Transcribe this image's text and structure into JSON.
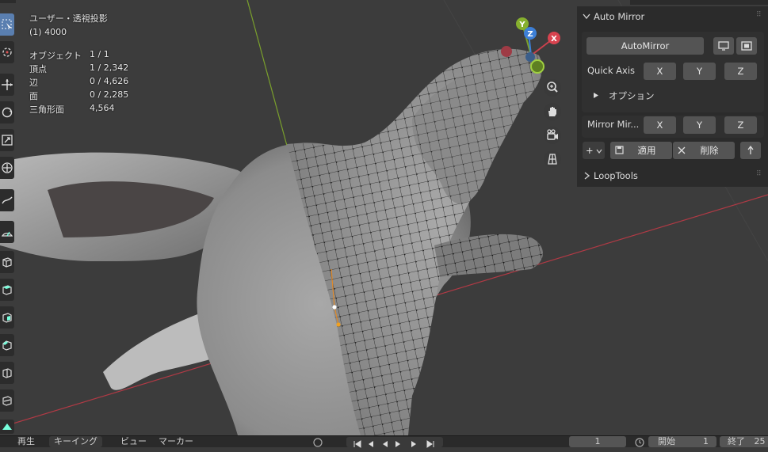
{
  "viewport": {
    "view_name": "ユーザー・透視投影",
    "object_name": "(1) 4000",
    "stats": [
      {
        "label": "オブジェクト",
        "value": "1 / 1"
      },
      {
        "label": "頂点",
        "value": "1 / 2,342"
      },
      {
        "label": "辺",
        "value": "0 / 4,626"
      },
      {
        "label": "面",
        "value": "0 / 2,285"
      },
      {
        "label": "三角形面",
        "value": "4,564"
      }
    ],
    "gizmo": {
      "x": "X",
      "y": "Y",
      "z": "Z"
    }
  },
  "toolbar": {
    "tools": [
      "select-box",
      "cursor",
      "move",
      "rotate",
      "scale",
      "transform",
      "annotate",
      "measure",
      "add-cube",
      "extrude",
      "inset",
      "bevel",
      "loop-cut",
      "knife",
      "poly-build"
    ]
  },
  "npanel": {
    "auto_mirror": {
      "title": "Auto Mirror",
      "automirror_button": "AutoMirror",
      "quick_axis_label": "Quick Axis",
      "axes": [
        "X",
        "Y",
        "Z"
      ],
      "options_label": "オプション",
      "mirror_label": "Mirror Mir...",
      "mirror_axes": [
        "X",
        "Y",
        "Z"
      ],
      "add_label": "+",
      "apply_label": "適用",
      "delete_label": "削除"
    },
    "looptools": {
      "title": "LoopTools"
    }
  },
  "timeline": {
    "items": [
      "再生",
      "キーイング",
      "ビュー",
      "マーカー"
    ],
    "frame": "1",
    "start_label": "開始",
    "start_value": "1",
    "end_label": "終了",
    "end_value": "25"
  },
  "colors": {
    "viewport_bg": "#3a3a3a",
    "panel_bg": "#2b2b2b",
    "button_bg": "#545454",
    "axis_x": "#c8414c",
    "axis_y": "#7aa02c",
    "axis_z": "#3d7fd6"
  }
}
